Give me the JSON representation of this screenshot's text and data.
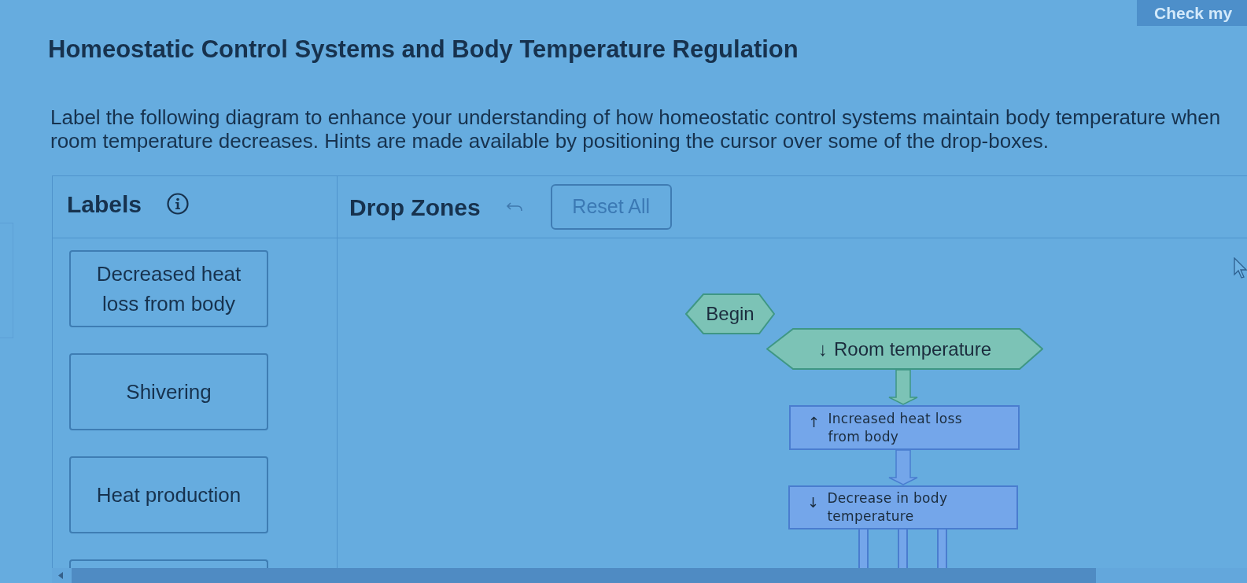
{
  "top_bar": {
    "check_button": "Check my"
  },
  "title": "Homeostatic Control Systems and Body Temperature Regulation",
  "instructions": "Label the following diagram to enhance your understanding of how homeostatic control systems maintain body temperature when room temperature decreases. Hints are made available by positioning the cursor over some of the drop-boxes.",
  "labels_panel": {
    "heading": "Labels",
    "cards": [
      "Decreased heat loss from body",
      "Shivering",
      "Heat production"
    ],
    "partial_card_below": true
  },
  "drop_zones_panel": {
    "heading": "Drop Zones",
    "reset_button": "Reset All"
  },
  "diagram": {
    "nodes": [
      {
        "kind": "start",
        "text": "Begin"
      },
      {
        "kind": "trigger",
        "arrow": "↓",
        "text": "Room temperature"
      },
      {
        "kind": "step",
        "arrow": "↑",
        "text": "Increased heat loss from body"
      },
      {
        "kind": "step",
        "arrow": "↓",
        "text": "Decrease in body temperature"
      }
    ]
  }
}
